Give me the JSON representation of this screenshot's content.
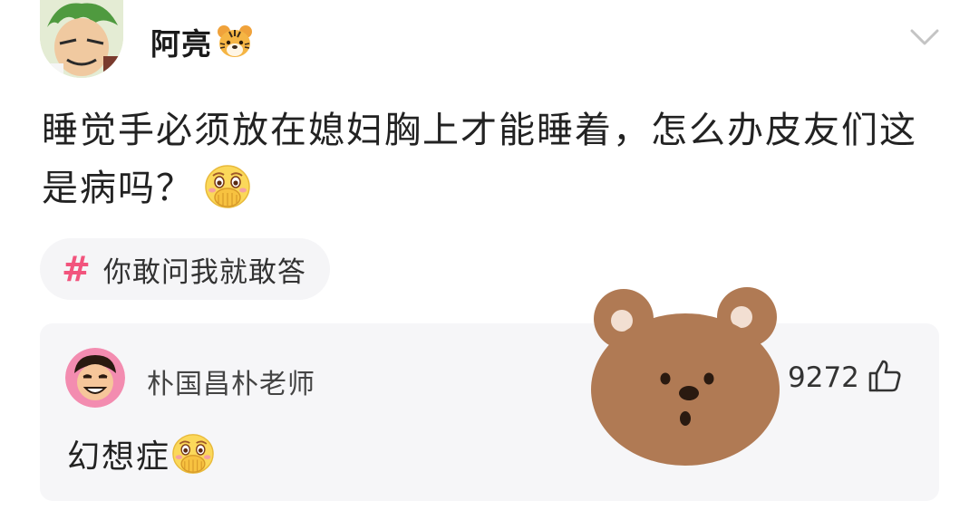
{
  "post": {
    "author": "阿亮",
    "author_badge_icon": "tiger-face-icon",
    "menu_icon": "chevron-down-icon",
    "text": "睡觉手必须放在媳妇胸上才能睡着，怎么办皮友们这是病吗？",
    "text_emoji_icon": "face-covering-mouth-icon",
    "topic_icon": "hashtag-icon",
    "topic": "你敢问我就敢答"
  },
  "comment": {
    "author": "朴国昌朴老师",
    "text": "幻想症",
    "text_emoji_icon": "face-covering-mouth-icon",
    "like_count": "9272",
    "like_icon": "thumbs-up-icon"
  },
  "sticker": {
    "icon": "bear-face-sticker"
  },
  "colors": {
    "accent_pink": "#f2547d",
    "chip_bg": "#f5f5f7",
    "card_bg": "#f6f6f8",
    "bear_brown": "#b07a54"
  }
}
